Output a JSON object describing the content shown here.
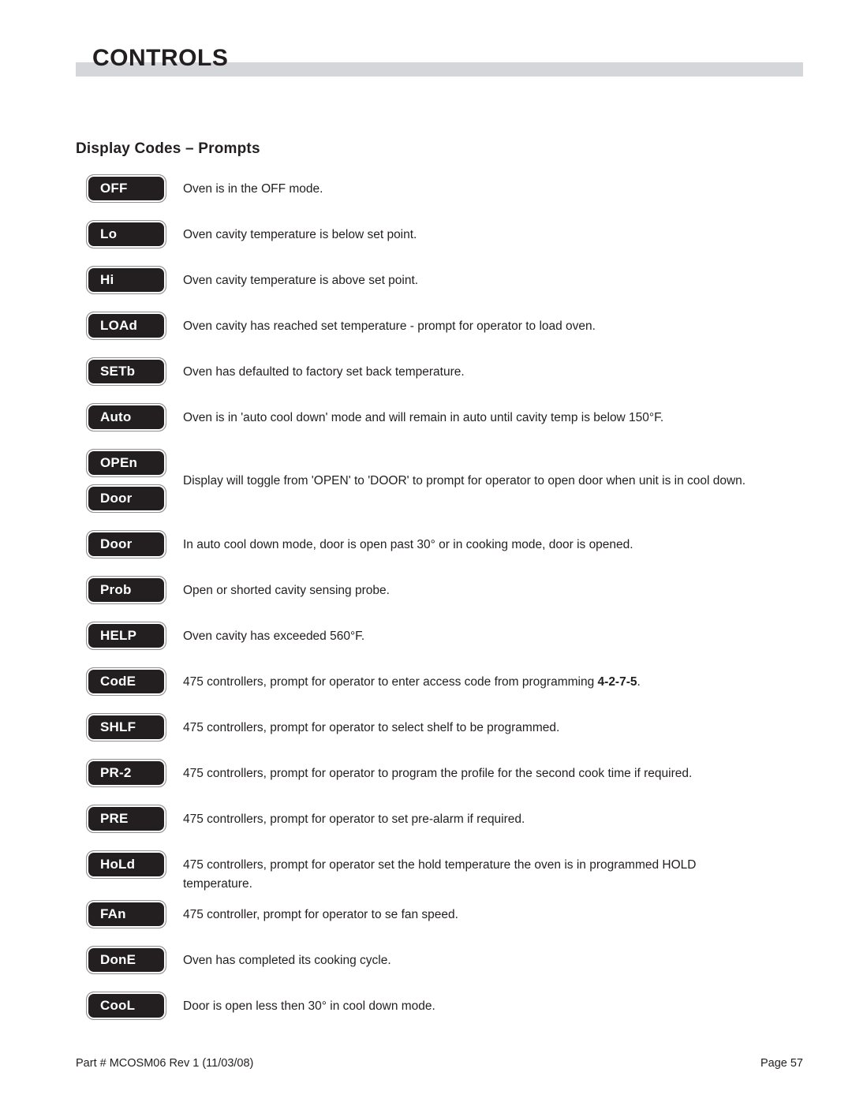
{
  "header": {
    "title": "CONTROLS",
    "bar_color": "#d5d6da"
  },
  "section": {
    "title": "Display Codes – Prompts"
  },
  "colors": {
    "badge_fill": "#231f20",
    "badge_text": "#ffffff",
    "badge_outline": "#8d8d93",
    "body_text": "#231f20",
    "header_bar": "#d5d6da"
  },
  "rows": [
    {
      "code": "OFF",
      "desc": "Oven is in the OFF mode."
    },
    {
      "code": "Lo",
      "desc": "Oven cavity temperature is below set point."
    },
    {
      "code": "Hi",
      "desc": "Oven cavity temperature is above set point."
    },
    {
      "code": "LOAd",
      "desc": "Oven cavity has reached set temperature - prompt for operator to load oven."
    },
    {
      "code": "SETb",
      "desc": "Oven has defaulted to factory set back temperature."
    },
    {
      "code": "Auto",
      "desc": "Oven is in 'auto cool down' mode and will remain in auto until cavity temp is below 150°F."
    }
  ],
  "pair_row": {
    "code_top": "OPEn",
    "code_bottom": "Door",
    "desc": "Display will toggle from 'OPEN' to 'DOOR' to prompt for operator to open door when unit is in cool down."
  },
  "rows2": [
    {
      "code": "Door",
      "desc": "In auto cool down mode, door is open past 30° or in cooking mode, door is opened."
    },
    {
      "code": "Prob",
      "desc": "Open or shorted cavity sensing probe."
    },
    {
      "code": "HELP",
      "desc": "Oven cavity has exceeded 560°F."
    }
  ],
  "code_row": {
    "code": "CodE",
    "desc_before": "475 controllers, prompt for operator to enter access code from programming ",
    "desc_bold": "4-2-7-5",
    "desc_after": "."
  },
  "rows3": [
    {
      "code": "SHLF",
      "desc": "475 controllers, prompt for operator to select shelf to be programmed."
    },
    {
      "code": "PR-2",
      "desc": "475 controllers, prompt for operator to program the profile for the second cook time if required."
    },
    {
      "code": "PRE",
      "desc": "475 controllers, prompt for operator to set pre-alarm if required."
    },
    {
      "code": "HoLd",
      "desc": "475 controllers, prompt for operator set the hold temperature the oven is in programmed HOLD temperature."
    },
    {
      "code": "FAn",
      "desc": "475 controller, prompt for operator to se fan speed."
    },
    {
      "code": "DonE",
      "desc": "Oven has completed its cooking cycle."
    },
    {
      "code": "CooL",
      "desc": "Door is open less then 30° in cool down mode."
    }
  ],
  "footer": {
    "part": "Part # MCOSM06 Rev 1 (11/03/08)",
    "page": "Page 57"
  }
}
